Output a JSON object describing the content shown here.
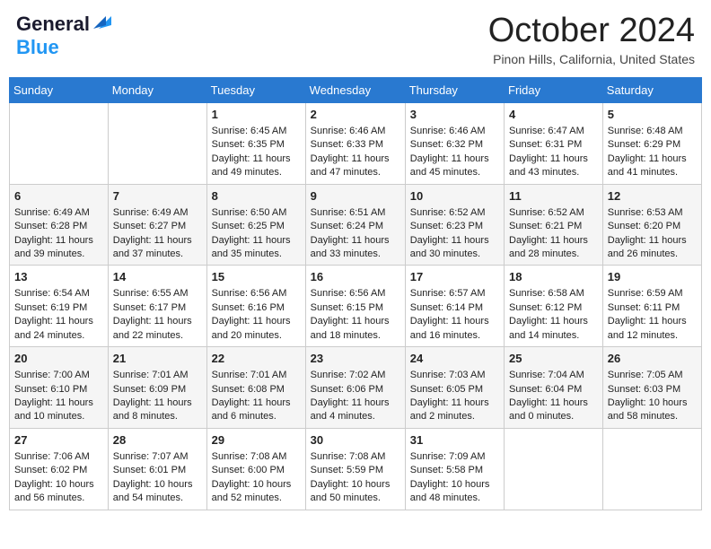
{
  "header": {
    "logo_line1": "General",
    "logo_line2": "Blue",
    "month": "October 2024",
    "location": "Pinon Hills, California, United States"
  },
  "days_of_week": [
    "Sunday",
    "Monday",
    "Tuesday",
    "Wednesday",
    "Thursday",
    "Friday",
    "Saturday"
  ],
  "weeks": [
    [
      {
        "day": "",
        "sunrise": "",
        "sunset": "",
        "daylight": ""
      },
      {
        "day": "",
        "sunrise": "",
        "sunset": "",
        "daylight": ""
      },
      {
        "day": "1",
        "sunrise": "Sunrise: 6:45 AM",
        "sunset": "Sunset: 6:35 PM",
        "daylight": "Daylight: 11 hours and 49 minutes."
      },
      {
        "day": "2",
        "sunrise": "Sunrise: 6:46 AM",
        "sunset": "Sunset: 6:33 PM",
        "daylight": "Daylight: 11 hours and 47 minutes."
      },
      {
        "day": "3",
        "sunrise": "Sunrise: 6:46 AM",
        "sunset": "Sunset: 6:32 PM",
        "daylight": "Daylight: 11 hours and 45 minutes."
      },
      {
        "day": "4",
        "sunrise": "Sunrise: 6:47 AM",
        "sunset": "Sunset: 6:31 PM",
        "daylight": "Daylight: 11 hours and 43 minutes."
      },
      {
        "day": "5",
        "sunrise": "Sunrise: 6:48 AM",
        "sunset": "Sunset: 6:29 PM",
        "daylight": "Daylight: 11 hours and 41 minutes."
      }
    ],
    [
      {
        "day": "6",
        "sunrise": "Sunrise: 6:49 AM",
        "sunset": "Sunset: 6:28 PM",
        "daylight": "Daylight: 11 hours and 39 minutes."
      },
      {
        "day": "7",
        "sunrise": "Sunrise: 6:49 AM",
        "sunset": "Sunset: 6:27 PM",
        "daylight": "Daylight: 11 hours and 37 minutes."
      },
      {
        "day": "8",
        "sunrise": "Sunrise: 6:50 AM",
        "sunset": "Sunset: 6:25 PM",
        "daylight": "Daylight: 11 hours and 35 minutes."
      },
      {
        "day": "9",
        "sunrise": "Sunrise: 6:51 AM",
        "sunset": "Sunset: 6:24 PM",
        "daylight": "Daylight: 11 hours and 33 minutes."
      },
      {
        "day": "10",
        "sunrise": "Sunrise: 6:52 AM",
        "sunset": "Sunset: 6:23 PM",
        "daylight": "Daylight: 11 hours and 30 minutes."
      },
      {
        "day": "11",
        "sunrise": "Sunrise: 6:52 AM",
        "sunset": "Sunset: 6:21 PM",
        "daylight": "Daylight: 11 hours and 28 minutes."
      },
      {
        "day": "12",
        "sunrise": "Sunrise: 6:53 AM",
        "sunset": "Sunset: 6:20 PM",
        "daylight": "Daylight: 11 hours and 26 minutes."
      }
    ],
    [
      {
        "day": "13",
        "sunrise": "Sunrise: 6:54 AM",
        "sunset": "Sunset: 6:19 PM",
        "daylight": "Daylight: 11 hours and 24 minutes."
      },
      {
        "day": "14",
        "sunrise": "Sunrise: 6:55 AM",
        "sunset": "Sunset: 6:17 PM",
        "daylight": "Daylight: 11 hours and 22 minutes."
      },
      {
        "day": "15",
        "sunrise": "Sunrise: 6:56 AM",
        "sunset": "Sunset: 6:16 PM",
        "daylight": "Daylight: 11 hours and 20 minutes."
      },
      {
        "day": "16",
        "sunrise": "Sunrise: 6:56 AM",
        "sunset": "Sunset: 6:15 PM",
        "daylight": "Daylight: 11 hours and 18 minutes."
      },
      {
        "day": "17",
        "sunrise": "Sunrise: 6:57 AM",
        "sunset": "Sunset: 6:14 PM",
        "daylight": "Daylight: 11 hours and 16 minutes."
      },
      {
        "day": "18",
        "sunrise": "Sunrise: 6:58 AM",
        "sunset": "Sunset: 6:12 PM",
        "daylight": "Daylight: 11 hours and 14 minutes."
      },
      {
        "day": "19",
        "sunrise": "Sunrise: 6:59 AM",
        "sunset": "Sunset: 6:11 PM",
        "daylight": "Daylight: 11 hours and 12 minutes."
      }
    ],
    [
      {
        "day": "20",
        "sunrise": "Sunrise: 7:00 AM",
        "sunset": "Sunset: 6:10 PM",
        "daylight": "Daylight: 11 hours and 10 minutes."
      },
      {
        "day": "21",
        "sunrise": "Sunrise: 7:01 AM",
        "sunset": "Sunset: 6:09 PM",
        "daylight": "Daylight: 11 hours and 8 minutes."
      },
      {
        "day": "22",
        "sunrise": "Sunrise: 7:01 AM",
        "sunset": "Sunset: 6:08 PM",
        "daylight": "Daylight: 11 hours and 6 minutes."
      },
      {
        "day": "23",
        "sunrise": "Sunrise: 7:02 AM",
        "sunset": "Sunset: 6:06 PM",
        "daylight": "Daylight: 11 hours and 4 minutes."
      },
      {
        "day": "24",
        "sunrise": "Sunrise: 7:03 AM",
        "sunset": "Sunset: 6:05 PM",
        "daylight": "Daylight: 11 hours and 2 minutes."
      },
      {
        "day": "25",
        "sunrise": "Sunrise: 7:04 AM",
        "sunset": "Sunset: 6:04 PM",
        "daylight": "Daylight: 11 hours and 0 minutes."
      },
      {
        "day": "26",
        "sunrise": "Sunrise: 7:05 AM",
        "sunset": "Sunset: 6:03 PM",
        "daylight": "Daylight: 10 hours and 58 minutes."
      }
    ],
    [
      {
        "day": "27",
        "sunrise": "Sunrise: 7:06 AM",
        "sunset": "Sunset: 6:02 PM",
        "daylight": "Daylight: 10 hours and 56 minutes."
      },
      {
        "day": "28",
        "sunrise": "Sunrise: 7:07 AM",
        "sunset": "Sunset: 6:01 PM",
        "daylight": "Daylight: 10 hours and 54 minutes."
      },
      {
        "day": "29",
        "sunrise": "Sunrise: 7:08 AM",
        "sunset": "Sunset: 6:00 PM",
        "daylight": "Daylight: 10 hours and 52 minutes."
      },
      {
        "day": "30",
        "sunrise": "Sunrise: 7:08 AM",
        "sunset": "Sunset: 5:59 PM",
        "daylight": "Daylight: 10 hours and 50 minutes."
      },
      {
        "day": "31",
        "sunrise": "Sunrise: 7:09 AM",
        "sunset": "Sunset: 5:58 PM",
        "daylight": "Daylight: 10 hours and 48 minutes."
      },
      {
        "day": "",
        "sunrise": "",
        "sunset": "",
        "daylight": ""
      },
      {
        "day": "",
        "sunrise": "",
        "sunset": "",
        "daylight": ""
      }
    ]
  ]
}
